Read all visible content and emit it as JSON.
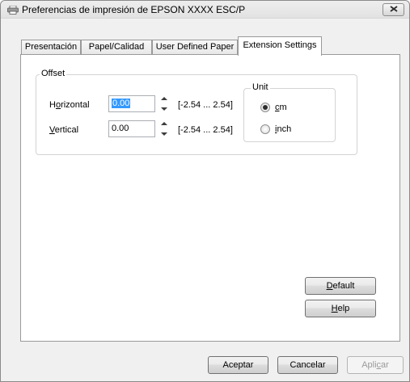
{
  "window": {
    "title": "Preferencias de impresión de EPSON XXXX ESC/P"
  },
  "tabs": [
    {
      "label": "Presentación"
    },
    {
      "label": "Papel/Calidad"
    },
    {
      "label": "User Defined Paper"
    },
    {
      "label": "Extension Settings",
      "active": true
    }
  ],
  "offset": {
    "group_label": "Offset",
    "horizontal": {
      "label_pre": "H",
      "label_u": "o",
      "label_post": "rizontal",
      "value": "0.00",
      "range": "[-2.54 ... 2.54]"
    },
    "vertical": {
      "label_u": "V",
      "label_post": "ertical",
      "value": "0.00",
      "range": "[-2.54 ... 2.54]"
    }
  },
  "unit": {
    "group_label": "Unit",
    "options": [
      {
        "u": "c",
        "rest": "m",
        "checked": true
      },
      {
        "u": "i",
        "rest": "nch",
        "checked": false
      }
    ]
  },
  "side_buttons": {
    "default": {
      "u": "D",
      "rest": "efault"
    },
    "help": {
      "u": "H",
      "rest": "elp"
    }
  },
  "footer": {
    "ok": "Aceptar",
    "cancel": "Cancelar",
    "apply_pre": "Apli",
    "apply_u": "c",
    "apply_post": "ar"
  }
}
